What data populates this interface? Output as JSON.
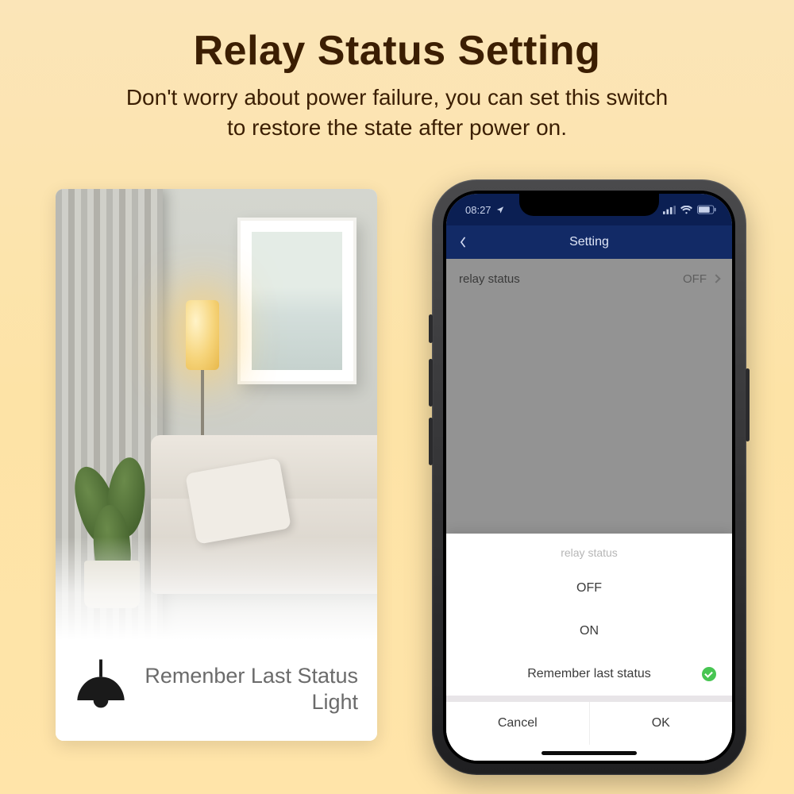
{
  "headline": {
    "title": "Relay Status Setting",
    "subtitle_l1": "Don't worry about power failure, you can set this switch",
    "subtitle_l2": "to restore the state after power on."
  },
  "left_card": {
    "caption_line1": "Remenber Last Status",
    "caption_line2": "Light"
  },
  "phone": {
    "status_time": "08:27",
    "nav_title": "Setting",
    "row": {
      "label": "relay status",
      "value": "OFF"
    },
    "sheet": {
      "title": "relay status",
      "options": [
        "OFF",
        "ON",
        "Remember last status"
      ],
      "selected_index": 2,
      "cancel": "Cancel",
      "ok": "OK"
    }
  }
}
